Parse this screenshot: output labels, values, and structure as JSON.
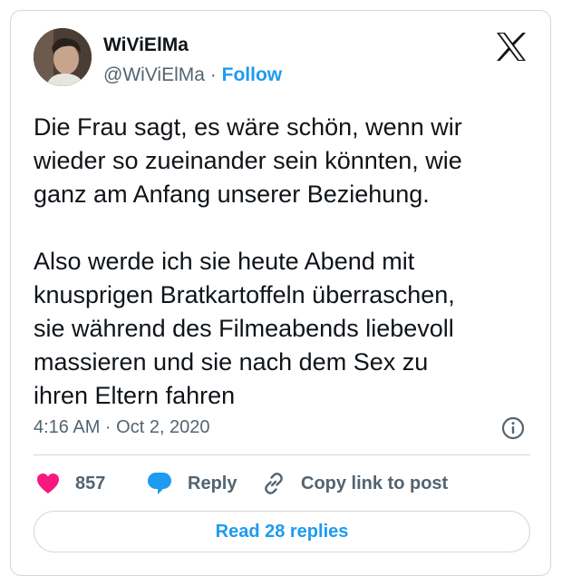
{
  "author": {
    "name": "WiViElMa",
    "handle": "@WiViElMa",
    "separator": "·",
    "follow_label": "Follow",
    "avatar_icon": "profile-photo"
  },
  "tweet": {
    "lines_paragraph1": [
      "Die Frau sagt, es wäre schön, wenn wir",
      "wieder so zueinander sein könnten, wie",
      "ganz am Anfang unserer Beziehung."
    ],
    "lines_paragraph2": [
      "Also werde ich sie heute Abend mit",
      "knusprigen Bratkartoffeln überraschen,",
      "sie während des Filmeabends liebevoll",
      "massieren und sie nach dem Sex zu",
      "ihren Eltern fahren"
    ],
    "timestamp": "4:16 AM · Oct 2, 2020"
  },
  "actions": {
    "like_count": "857",
    "reply_label": "Reply",
    "copy_label": "Copy link to post"
  },
  "footer": {
    "read_replies_label": "Read 28 replies"
  },
  "icons": {
    "platform": "x-logo-icon",
    "info": "info-icon",
    "like": "heart-icon",
    "reply": "speech-bubble-icon",
    "copy": "link-icon"
  },
  "colors": {
    "accent": "#1d9bf0",
    "like": "#f91880",
    "muted": "#536471",
    "text": "#0f1419",
    "border": "#cfd9de"
  }
}
